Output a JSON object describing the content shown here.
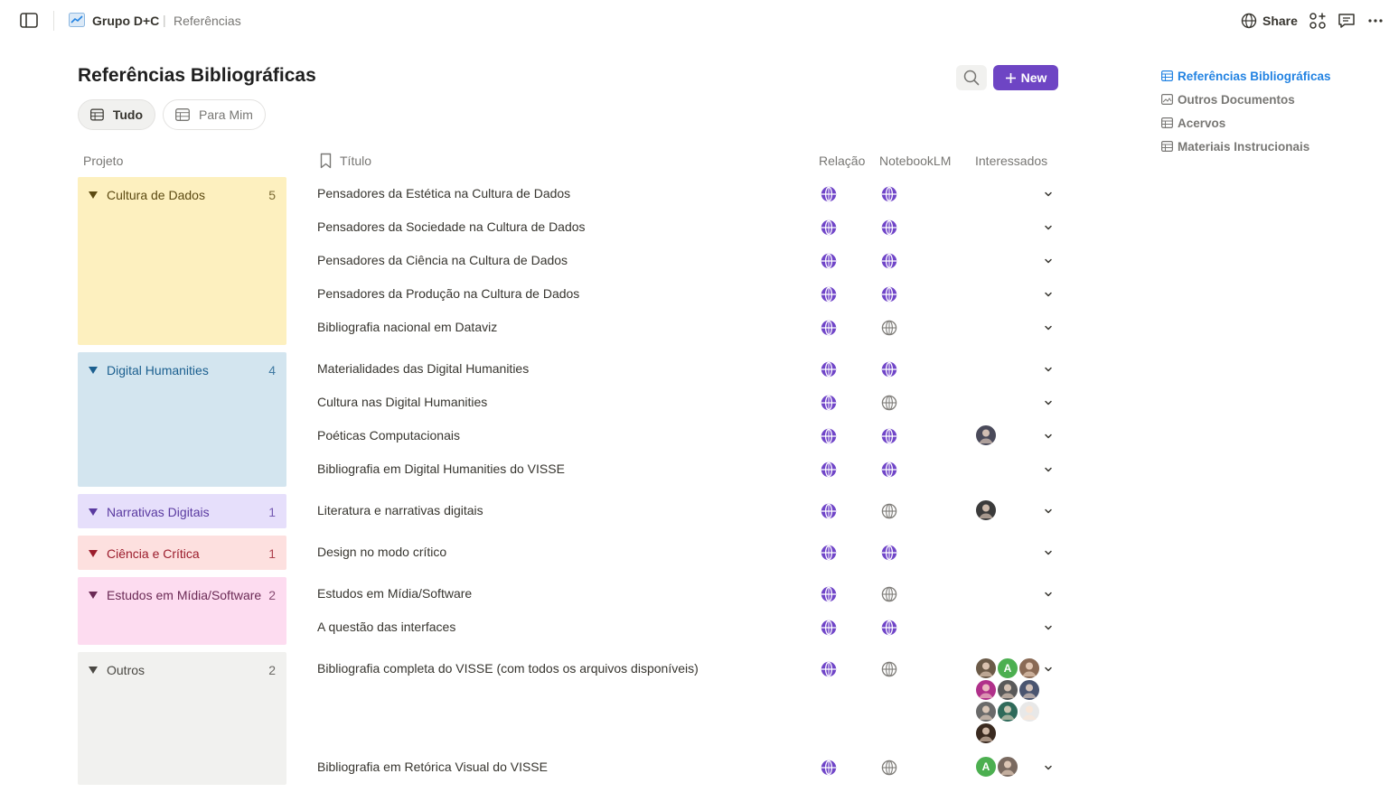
{
  "topbar": {
    "workspace": "Grupo D+C",
    "page": "Referências",
    "share_label": "Share"
  },
  "page": {
    "title": "Referências Bibliográficas",
    "new_label": "New",
    "views": [
      "Tudo",
      "Para Mim"
    ]
  },
  "columns": {
    "project": "Projeto",
    "title": "Título",
    "relation": "Relação",
    "notebook": "NotebookLM",
    "interested": "Interessados"
  },
  "toc": [
    "Referências Bibliográficas",
    "Outros Documentos",
    "Acervos",
    "Materiais Instrucionais"
  ],
  "groups": [
    {
      "name": "Cultura de Dados",
      "count": "5",
      "bg": "#fdecc8",
      "fg": "#402c1b"
    },
    {
      "name": "Digital Humanities",
      "count": "4",
      "bg": "#d3e5ef",
      "fg": "#183347"
    },
    {
      "name": "Narrativas Digitais",
      "count": "1",
      "bg": "#e8deee",
      "fg": "#412454"
    },
    {
      "name": "Ciência e Crítica",
      "count": "1",
      "bg": "#ffe2dd",
      "fg": "#5d1715"
    },
    {
      "name": "Estudos em Mídia/Software",
      "count": "2",
      "bg": "#f5e0e9",
      "fg": "#4c2337"
    },
    {
      "name": "Outros",
      "count": "2",
      "bg": "#f1f1ef",
      "fg": "#32302c"
    }
  ],
  "rows": [
    {
      "title": "Pensadores da Estética na Cultura de Dados",
      "relation": "filled",
      "notebook": "filled",
      "avatars": []
    },
    {
      "title": "Pensadores da Sociedade na Cultura de Dados",
      "relation": "filled",
      "notebook": "filled",
      "avatars": []
    },
    {
      "title": "Pensadores da Ciência na Cultura de Dados",
      "relation": "filled",
      "notebook": "filled",
      "avatars": []
    },
    {
      "title": "Pensadores da Produção na Cultura de Dados",
      "relation": "filled",
      "notebook": "filled",
      "avatars": []
    },
    {
      "title": "Bibliografia nacional em Dataviz",
      "relation": "filled",
      "notebook": "outline",
      "avatars": []
    },
    {
      "title": "Materialidades das Digital Humanities",
      "relation": "filled",
      "notebook": "filled",
      "avatars": []
    },
    {
      "title": "Cultura nas Digital Humanities",
      "relation": "filled",
      "notebook": "outline",
      "avatars": []
    },
    {
      "title": "Poéticas Computacionais",
      "relation": "filled",
      "notebook": "filled",
      "avatars": [
        {
          "color": "#4a4a5a"
        }
      ]
    },
    {
      "title": "Bibliografia em Digital Humanities do VISSE",
      "relation": "filled",
      "notebook": "filled",
      "avatars": []
    },
    {
      "title": "Literatura e narrativas digitais",
      "relation": "filled",
      "notebook": "outline",
      "avatars": [
        {
          "color": "#3b3b3b"
        }
      ]
    },
    {
      "title": "Design no modo crítico",
      "relation": "filled",
      "notebook": "filled",
      "avatars": []
    },
    {
      "title": "Estudos em Mídia/Software",
      "relation": "filled",
      "notebook": "outline",
      "avatars": []
    },
    {
      "title": "A questão das interfaces",
      "relation": "filled",
      "notebook": "filled",
      "avatars": []
    },
    {
      "title": "Bibliografia completa do VISSE (com todos os arquivos disponíveis)",
      "relation": "filled",
      "notebook": "outline",
      "avatars": [
        {
          "color": "#6b5a48"
        },
        {
          "color": "#4caf50",
          "initial": "A"
        },
        {
          "color": "#8a6a55"
        },
        {
          "color": "#b0308a"
        },
        {
          "color": "#5a5a5a"
        },
        {
          "color": "#4a5570"
        },
        {
          "color": "#6a6a6a"
        },
        {
          "color": "#2f6a5a"
        },
        {
          "color": "#e8e8e8"
        },
        {
          "color": "#3a2a20"
        }
      ]
    },
    {
      "title": "Bibliografia em Retórica Visual do VISSE",
      "relation": "filled",
      "notebook": "outline",
      "avatars": [
        {
          "color": "#4caf50",
          "initial": "A"
        },
        {
          "color": "#7a6a60"
        }
      ]
    }
  ],
  "colors": {
    "accent": "#6e45c4",
    "globe": "#6e45c4",
    "link": "#2383e2"
  }
}
